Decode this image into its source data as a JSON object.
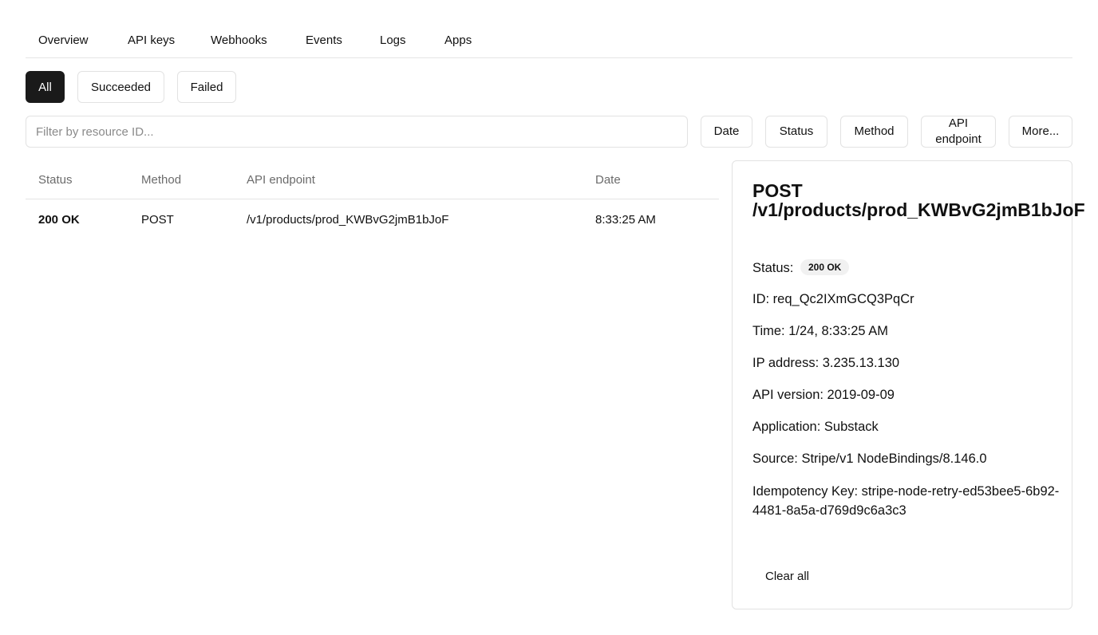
{
  "nav": {
    "tabs": [
      "Overview",
      "API keys",
      "Webhooks",
      "Events",
      "Logs",
      "Apps"
    ]
  },
  "status_filter": {
    "options": [
      "All",
      "Succeeded",
      "Failed"
    ],
    "selected": "All"
  },
  "search": {
    "placeholder": "Filter by resource ID...",
    "value": ""
  },
  "filters": {
    "date": "Date",
    "status": "Status",
    "method": "Method",
    "api_endpoint": "API endpoint",
    "more": "More..."
  },
  "table": {
    "headers": [
      "Status",
      "Method",
      "API endpoint",
      "Date"
    ],
    "rows": [
      {
        "status": "200 OK",
        "method": "POST",
        "endpoint": "/v1/products/prod_KWBvG2jmB1bJoF",
        "date": "8:33:25 AM"
      }
    ]
  },
  "detail": {
    "title": "POST /v1/products/prod_KWBvG2jmB1bJoF",
    "method": "POST",
    "path": "/v1/products/prod_KWBvG2jmB1bJoF",
    "status_label": "Status:",
    "status_value": "200 OK",
    "id": "ID: req_Qc2IXmGCQ3PqCr",
    "time": "Time: 1/24, 8:33:25 AM",
    "ip": "IP address: 3.235.13.130",
    "api_version": "API version: 2019-09-09",
    "application": "Application: Substack",
    "source": "Source: Stripe/v1 NodeBindings/8.146.0",
    "idempotency": "Idempotency Key: stripe-node-retry-ed53bee5-6b92-4481-8a5a-d769d9c6a3c3",
    "clear_label": "Clear all"
  },
  "colors": {
    "active_bg": "#1a1a1a",
    "border": "#e2e2e2",
    "muted_text": "#6b6b6b",
    "badge_bg": "#f1f1f1"
  }
}
